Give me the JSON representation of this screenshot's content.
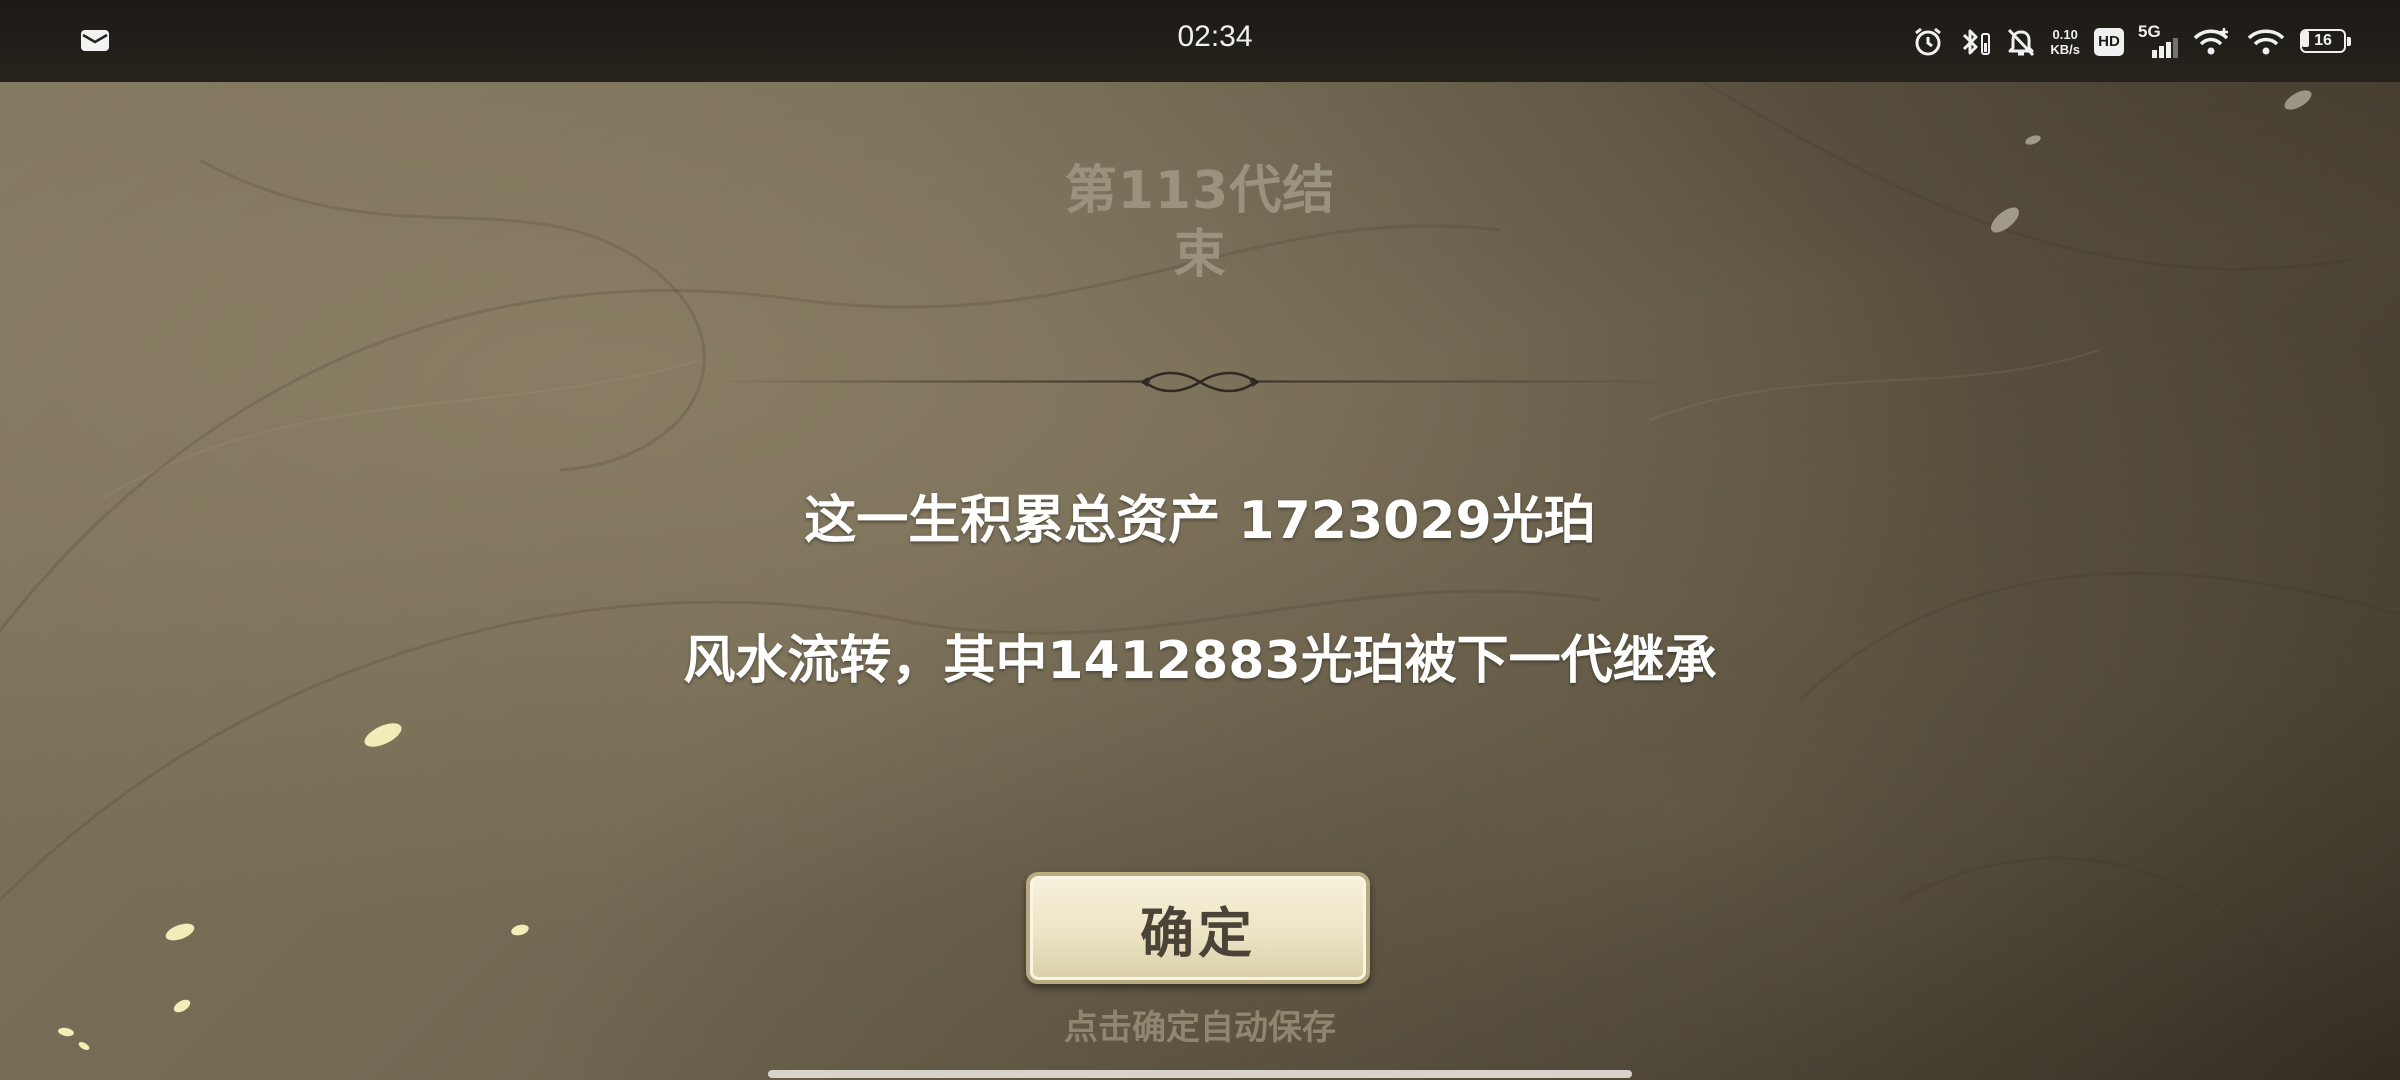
{
  "status_bar": {
    "time": "02:34",
    "net_speed_value": "0.10",
    "net_speed_unit": "KB/s",
    "hd_badge": "HD",
    "network_type": "5G",
    "battery_level": "16",
    "battery_fraction": 0.16,
    "icons": [
      "mail-icon",
      "alarm-icon",
      "bluetooth-icon",
      "mute-icon",
      "hd-icon",
      "signal-icon",
      "wifi-calling-icon",
      "wifi-icon",
      "battery-icon"
    ]
  },
  "dialog": {
    "title_line1": "第113代结",
    "title_line2": "束",
    "message_total": "这一生积累总资产 1723029光珀",
    "message_inherit": "风水流转，其中1412883光珀被下一代继承",
    "confirm_label": "确定",
    "hint": "点击确定自动保存"
  },
  "colors": {
    "background": "#746a54",
    "title": "#9b927d",
    "message": "#ffffff",
    "button_face": "#ece4c4",
    "button_text": "#4a4438",
    "hint": "#8f866f"
  }
}
